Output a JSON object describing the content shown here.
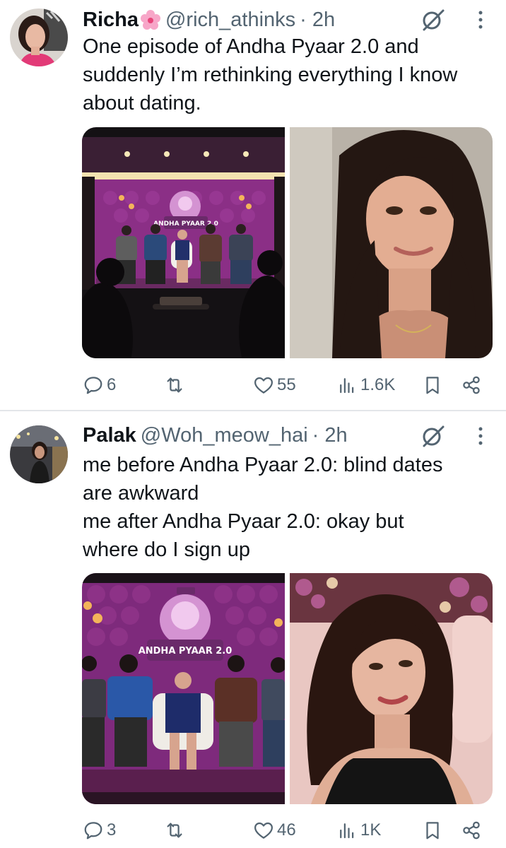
{
  "tweets": [
    {
      "name": "Richa",
      "name_emoji_icon": "cherry-blossom-icon",
      "handle": "@rich_athinks",
      "time": "· 2h",
      "text_lines": [
        "One episode of Andha Pyaar 2.0 and",
        "suddenly I’m rethinking everything I know",
        "about dating."
      ],
      "media_logo_text": "ANDHA PYAAR 2.0",
      "replies": "6",
      "reposts": "",
      "likes": "55",
      "views": "1.6K"
    },
    {
      "name": "Palak",
      "handle": "@Woh_meow_hai",
      "time": "· 2h",
      "text_lines": [
        "me before Andha Pyaar 2.0: blind dates",
        "are awkward",
        "me after Andha Pyaar 2.0: okay but",
        "where do I sign up"
      ],
      "media_logo_text": "ANDHA PYAAR 2.0",
      "replies": "3",
      "reposts": "",
      "likes": "46",
      "views": "1K"
    }
  ],
  "colors": {
    "text": "#0f1419",
    "secondary": "#536471",
    "divider": "#e3e6e9",
    "stage_purple": "#8b2f86"
  },
  "icons": [
    "reply-icon",
    "repost-icon",
    "like-icon",
    "views-icon",
    "bookmark-icon",
    "share-icon",
    "grok-icon",
    "more-icon"
  ]
}
